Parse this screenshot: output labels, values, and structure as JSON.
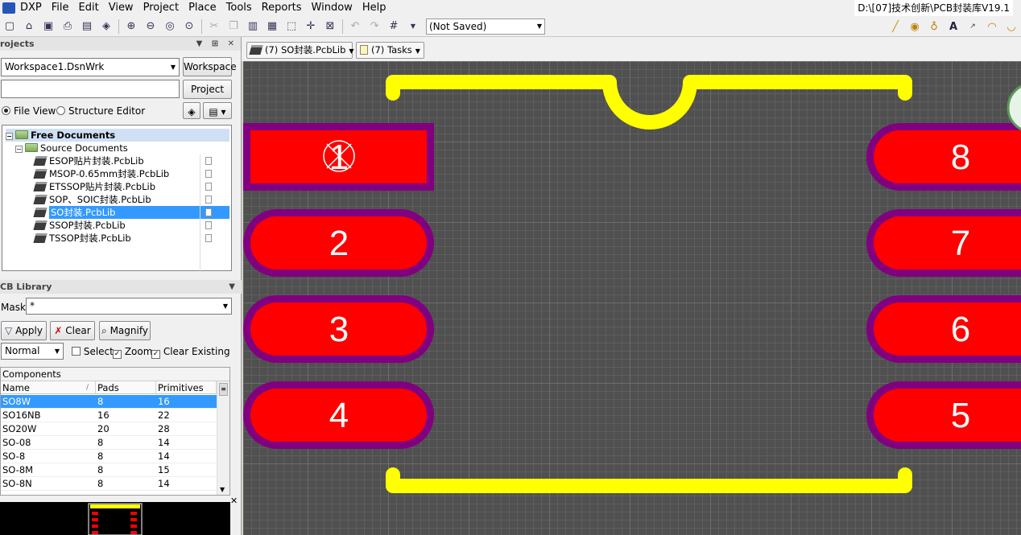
{
  "menubar": {
    "items": [
      "DXP",
      "File",
      "Edit",
      "View",
      "Project",
      "Place",
      "Tools",
      "Reports",
      "Window",
      "Help"
    ],
    "path": "D:\\[07]技术创新\\PCB封装库V19.1"
  },
  "toolbar": {
    "status_combo": "(Not Saved)"
  },
  "projects_panel": {
    "title": "rojects",
    "workspace_combo": "Workspace1.DsnWrk",
    "workspace_button": "Workspace",
    "project_button": "Project",
    "file_view_label": "File View",
    "structure_editor_label": "Structure Editor",
    "tree": {
      "root": "Free Documents",
      "group": "Source Documents",
      "files": [
        "ESOP贴片封装.PcbLib",
        "MSOP-0.65mm封装.PcbLib",
        "ETSSOP贴片封装.PcbLib",
        "SOP、SOIC封装.PcbLib",
        "SO封装.PcbLib",
        "SSOP封装.PcbLib",
        "TSSOP封装.PcbLib"
      ],
      "selected_index": 4
    }
  },
  "library_panel": {
    "title": "CB Library",
    "mask_label": "Mask",
    "mask_value": "*",
    "apply_button": "Apply",
    "clear_button": "Clear",
    "magnify_button": "Magnify",
    "mode_combo": "Normal",
    "select_label": "Select",
    "zoom_label": "Zoom",
    "clear_existing_label": "Clear Existing",
    "components_title": "Components",
    "columns": [
      "Name",
      "Pads",
      "Primitives"
    ],
    "rows": [
      [
        "SO8W",
        "8",
        "16"
      ],
      [
        "SO16NB",
        "16",
        "22"
      ],
      [
        "SO20W",
        "20",
        "28"
      ],
      [
        "SO-08",
        "8",
        "14"
      ],
      [
        "SO-8",
        "8",
        "14"
      ],
      [
        "SO-8M",
        "8",
        "15"
      ],
      [
        "SO-8N",
        "8",
        "14"
      ]
    ],
    "selected_row": 0
  },
  "tabs": {
    "doc_tab": "(7) SO封装.PcbLib",
    "tasks_tab": "(7) Tasks"
  },
  "canvas": {
    "pads_left": [
      "1",
      "2",
      "3",
      "4"
    ],
    "pads_right": [
      "8",
      "7",
      "6",
      "5"
    ],
    "colors": {
      "pad": "#ff0000",
      "pad_mask": "#800080",
      "silkscreen": "#ffff00",
      "grid_bg": "#505050"
    }
  }
}
